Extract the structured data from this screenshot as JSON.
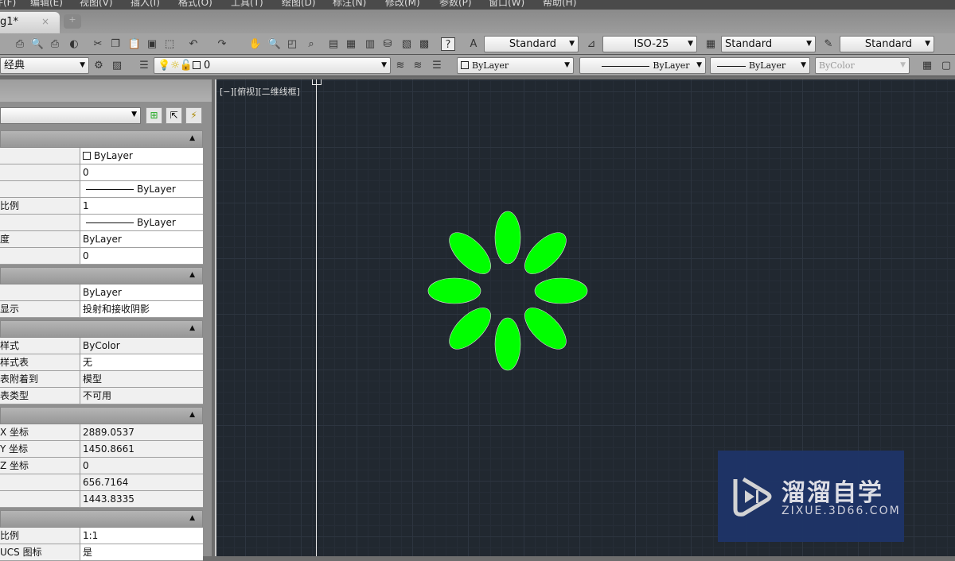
{
  "menu": [
    "件(F)",
    "编辑(E)",
    "视图(V)",
    "插入(I)",
    "格式(O)",
    "工具(T)",
    "绘图(D)",
    "标注(N)",
    "修改(M)",
    "参数(P)",
    "窗口(W)",
    "帮助(H)"
  ],
  "tab": {
    "title": "g1*",
    "close": "×",
    "new": "+"
  },
  "styles": {
    "text_style": "Standard",
    "dim_style": "ISO-25",
    "table_style": "Standard",
    "mleader_style": "Standard"
  },
  "workspace": "经典",
  "layer": "0",
  "props_bar": {
    "color": "ByLayer",
    "linetype": "ByLayer",
    "lineweight": "ByLayer",
    "plotstyle": "ByColor"
  },
  "viewport_label": "[−][俯视][二维线框]",
  "properties": {
    "sections": [
      {
        "rows": [
          {
            "k": "",
            "v": "ByLayer",
            "t": "sq"
          },
          {
            "k": "",
            "v": "0"
          },
          {
            "k": "",
            "v": "ByLayer",
            "t": "ln"
          },
          {
            "k": "比例",
            "v": "1"
          },
          {
            "k": "",
            "v": "ByLayer",
            "t": "ln"
          },
          {
            "k": "度",
            "v": "ByLayer"
          },
          {
            "k": "",
            "v": "0"
          }
        ]
      },
      {
        "rows": [
          {
            "k": "",
            "v": "ByLayer"
          },
          {
            "k": "显示",
            "v": "投射和接收阴影"
          }
        ]
      },
      {
        "rows": [
          {
            "k": "样式",
            "v": "ByColor",
            "g": 1
          },
          {
            "k": "样式表",
            "v": "无"
          },
          {
            "k": "表附着到",
            "v": "模型",
            "g": 1
          },
          {
            "k": "表类型",
            "v": "不可用",
            "g": 1
          }
        ]
      },
      {
        "rows": [
          {
            "k": "X 坐标",
            "v": "2889.0537",
            "g": 1
          },
          {
            "k": "Y 坐标",
            "v": "1450.8661",
            "g": 1
          },
          {
            "k": "Z 坐标",
            "v": "0",
            "g": 1
          },
          {
            "k": "",
            "v": "656.7164",
            "g": 1
          },
          {
            "k": "",
            "v": "1443.8335",
            "g": 1
          }
        ]
      },
      {
        "rows": [
          {
            "k": "比例",
            "v": "1:1"
          },
          {
            "k": "UCS 图标",
            "v": "是"
          }
        ]
      }
    ]
  },
  "drawing": {
    "petal_color": "#00ff00",
    "petal_count": 8
  },
  "watermark": {
    "cn": "溜溜自学",
    "en": "ZIXUE.3D66.COM"
  }
}
